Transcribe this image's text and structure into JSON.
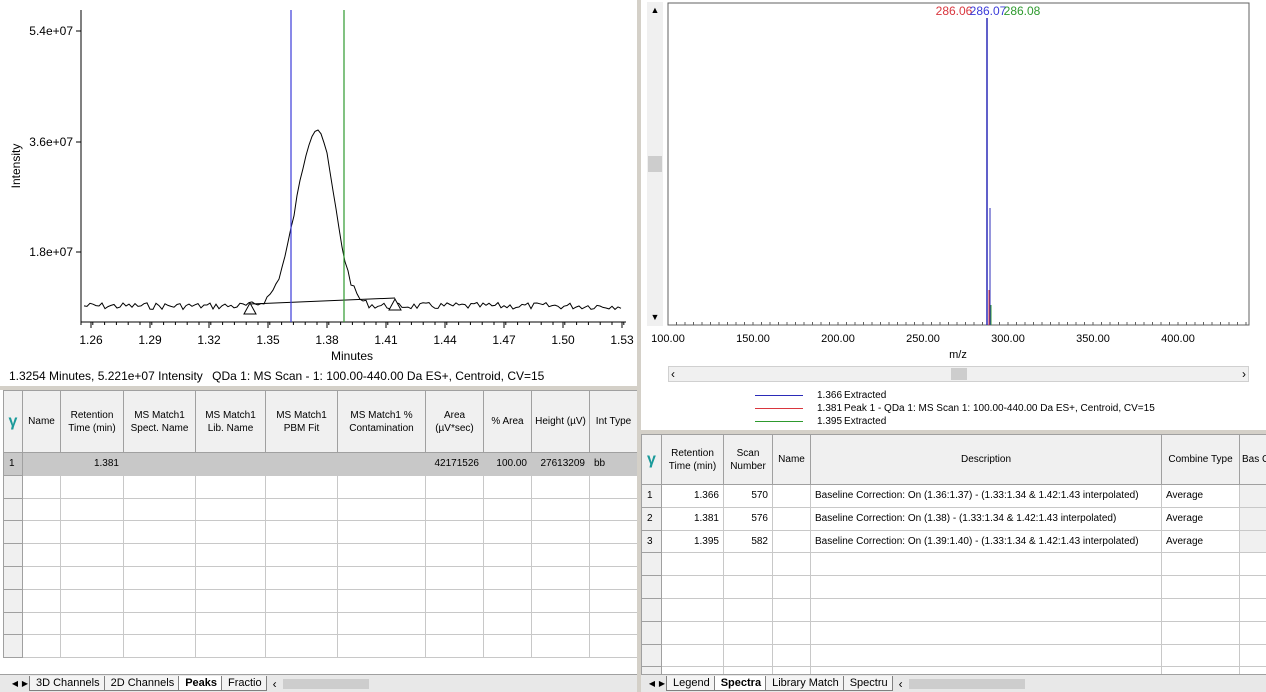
{
  "chromatogram": {
    "y_axis_label": "Intensity",
    "x_axis_label": "Minutes",
    "y_ticks": [
      "5.4e+07",
      "3.6e+07",
      "1.8e+07"
    ],
    "x_ticks": [
      "1.26",
      "1.29",
      "1.32",
      "1.35",
      "1.38",
      "1.41",
      "1.44",
      "1.47",
      "1.50",
      "1.53"
    ],
    "status_cursor": "1.3254 Minutes, 5.221e+07 Intensity",
    "status_channel": "QDa 1: MS Scan - 1: 100.00-440.00 Da ES+, Centroid, CV=15",
    "marker_colors": {
      "blue": "#3b3bd9",
      "green": "#2e9a2e"
    }
  },
  "spectrum": {
    "x_axis_label": "m/z",
    "x_ticks": [
      "100.00",
      "150.00",
      "200.00",
      "250.00",
      "300.00",
      "350.00",
      "400.00"
    ],
    "peak_labels": [
      "286.06",
      "286.07",
      "286.08"
    ],
    "peak_label_colors": [
      "#d9363e",
      "#3b3bd9",
      "#2e9a2e"
    ],
    "legend": [
      {
        "time": "1.366",
        "text": "Extracted",
        "color": "#2b2bb8"
      },
      {
        "time": "1.381",
        "text": "Peak 1 - QDa 1: MS Scan 1: 100.00-440.00 Da ES+, Centroid, CV=15",
        "color": "#d9363e"
      },
      {
        "time": "1.395",
        "text": "Extracted",
        "color": "#2e9a2e"
      }
    ]
  },
  "peaks_table": {
    "headers": {
      "name": "Name",
      "rt": "Retention Time (min)",
      "spect_name": "MS Match1 Spect. Name",
      "lib_name": "MS Match1 Lib. Name",
      "pbm_fit": "MS Match1 PBM Fit",
      "contamination": "MS Match1 % Contamination",
      "area": "Area (µV*sec)",
      "pct_area": "% Area",
      "height": "Height (µV)",
      "int_type": "Int Type"
    },
    "rows": [
      {
        "index": "1",
        "name": "",
        "rt": "1.381",
        "spect_name": "",
        "lib_name": "",
        "pbm_fit": "",
        "contamination": "",
        "area": "42171526",
        "pct_area": "100.00",
        "height": "27613209",
        "int_type": "bb"
      }
    ]
  },
  "left_tabs": [
    "3D Channels",
    "2D Channels",
    "Peaks",
    "Fractio"
  ],
  "spectra_table": {
    "headers": {
      "rt": "Retention Time (min)",
      "scan": "Scan Number",
      "name": "Name",
      "description": "Description",
      "combine": "Combine Type",
      "base": "Bas Corr"
    },
    "rows": [
      {
        "index": "1",
        "rt": "1.366",
        "scan": "570",
        "name": "",
        "description": "Baseline Correction: On (1.36:1.37)  - (1.33:1.34 & 1.42:1.43 interpolated)",
        "combine": "Average"
      },
      {
        "index": "2",
        "rt": "1.381",
        "scan": "576",
        "name": "",
        "description": "Baseline Correction: On (1.38)  - (1.33:1.34 & 1.42:1.43 interpolated)",
        "combine": "Average"
      },
      {
        "index": "3",
        "rt": "1.395",
        "scan": "582",
        "name": "",
        "description": "Baseline Correction: On (1.39:1.40)  - (1.33:1.34 & 1.42:1.43 interpolated)",
        "combine": "Average"
      }
    ]
  },
  "right_tabs": [
    "Legend",
    "Spectra",
    "Library Match",
    "Spectru"
  ],
  "icons": {
    "filter": "filter-icon",
    "scroll_left": "arrow-left-icon",
    "scroll_right": "arrow-right-icon",
    "scroll_up": "arrow-up-icon",
    "scroll_down": "arrow-down-icon"
  }
}
